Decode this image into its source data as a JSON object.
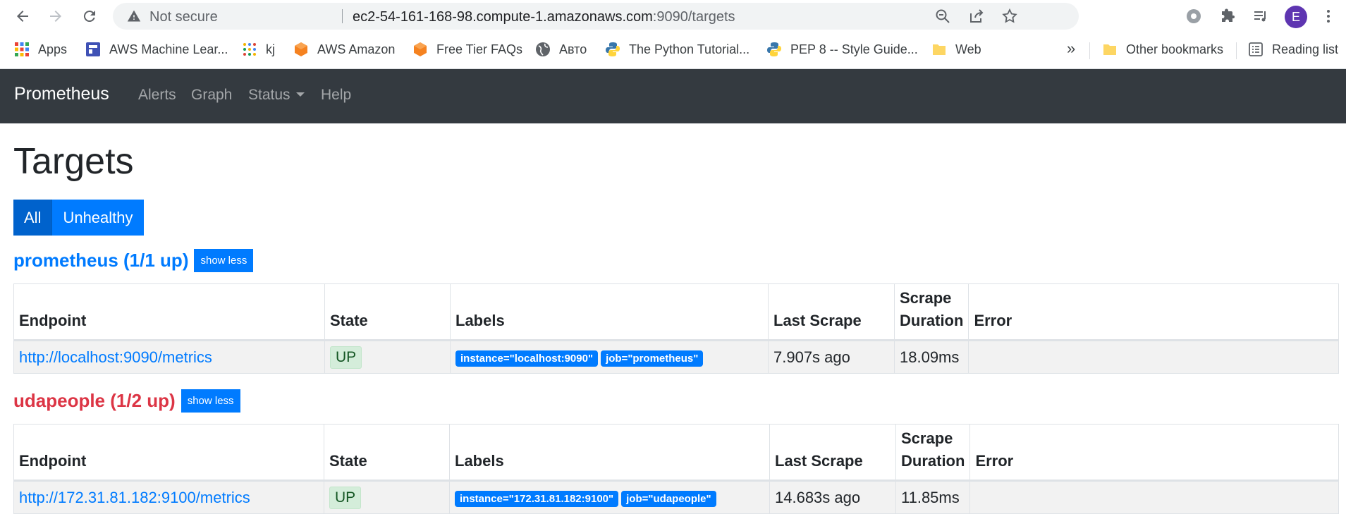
{
  "browser": {
    "security_label": "Not secure",
    "url_host": "ec2-54-161-168-98.compute-1.amazonaws.com",
    "url_rest": ":9090/targets",
    "avatar_letter": "E"
  },
  "bookmarks": {
    "items": [
      {
        "label": "Apps",
        "icon": "apps-grid-icon"
      },
      {
        "label": "AWS Machine Lear...",
        "icon": "aws-ml-icon"
      },
      {
        "label": "kj",
        "icon": "dots-icon"
      },
      {
        "label": "AWS Amazon",
        "icon": "aws-hex-icon"
      },
      {
        "label": "Free Tier FAQs",
        "icon": "aws-hex-icon"
      },
      {
        "label": "Авто",
        "icon": "globe-icon"
      },
      {
        "label": "The Python Tutorial...",
        "icon": "python-icon"
      },
      {
        "label": "PEP 8 -- Style Guide...",
        "icon": "python-icon"
      },
      {
        "label": "Web",
        "icon": "folder-icon"
      }
    ],
    "overflow": "»",
    "other": "Other bookmarks",
    "reading_list": "Reading list"
  },
  "navbar": {
    "brand": "Prometheus",
    "links": [
      "Alerts",
      "Graph",
      "Status",
      "Help"
    ]
  },
  "page": {
    "title": "Targets",
    "filters": {
      "all": "All",
      "unhealthy": "Unhealthy"
    }
  },
  "columns": {
    "endpoint": "Endpoint",
    "state": "State",
    "labels": "Labels",
    "last_scrape": "Last Scrape",
    "scrape_duration": "Scrape Duration",
    "error": "Error"
  },
  "jobs": [
    {
      "title": "prometheus (1/1 up)",
      "toggle": "show less",
      "row": {
        "endpoint": "http://localhost:9090/metrics",
        "state": "UP",
        "labels": [
          "instance=\"localhost:9090\"",
          "job=\"prometheus\""
        ],
        "last_scrape": "7.907s ago",
        "scrape_duration": "18.09ms",
        "error": ""
      }
    },
    {
      "title": "udapeople (1/2 up)",
      "toggle": "show less",
      "row": {
        "endpoint": "http://172.31.81.182:9100/metrics",
        "state": "UP",
        "labels": [
          "instance=\"172.31.81.182:9100\"",
          "job=\"udapeople\""
        ],
        "last_scrape": "14.683s ago",
        "scrape_duration": "11.85ms",
        "error": ""
      }
    }
  ],
  "colors": {
    "navbar_bg": "#343a40",
    "primary": "#007bff",
    "danger": "#dc3545",
    "up_badge_bg": "#d4edda"
  }
}
